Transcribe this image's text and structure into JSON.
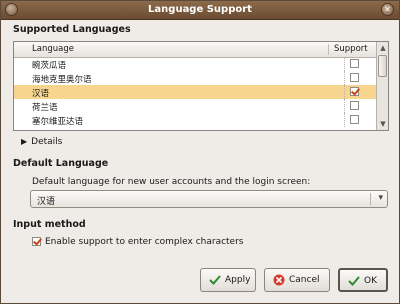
{
  "window": {
    "title": "Language Support"
  },
  "supported": {
    "heading": "Supported Languages",
    "columns": {
      "language": "Language",
      "support": "Support"
    },
    "rows": [
      {
        "language": "畹茨瓜语",
        "checked": false,
        "selected": false
      },
      {
        "language": "海地克里奥尔语",
        "checked": false,
        "selected": false
      },
      {
        "language": "汉语",
        "checked": true,
        "selected": true
      },
      {
        "language": "荷兰语",
        "checked": false,
        "selected": false
      },
      {
        "language": "塞尔维亚达语",
        "checked": false,
        "selected": false
      }
    ],
    "details": "Details"
  },
  "default_language": {
    "heading": "Default Language",
    "description": "Default language for new user accounts and the login screen:",
    "value": "汉语"
  },
  "input_method": {
    "heading": "Input method",
    "checkbox_label": "Enable support to enter complex characters",
    "checked": true
  },
  "buttons": {
    "apply": "Apply",
    "cancel": "Cancel",
    "ok": "OK"
  },
  "colors": {
    "titlebar": "#7a5a3e",
    "selection": "#f7d58e",
    "check": "#c24a1a"
  }
}
